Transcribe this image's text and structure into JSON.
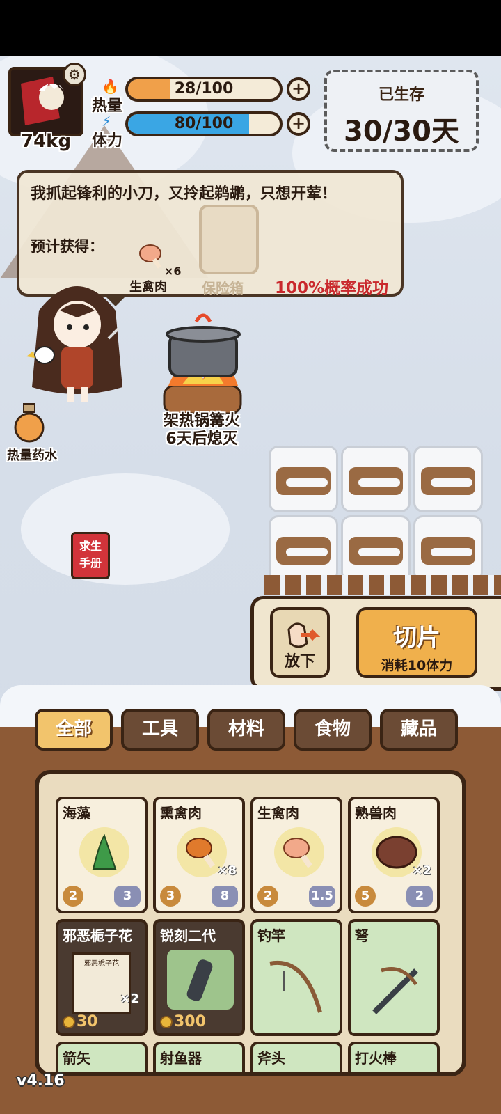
{
  "hud": {
    "weight": "74kg",
    "heat": {
      "label": "热量",
      "value": "28/100",
      "fraction": 0.28
    },
    "stamina": {
      "label": "体力",
      "value": "80/100",
      "fraction": 0.8
    },
    "survival": {
      "label": "已生存",
      "value": "30/30天"
    }
  },
  "dialog": {
    "text": "我抓起锋利的小刀，又拎起鹈鹕，只想开荤！",
    "expected_label": "预计获得：",
    "reward_name": "生禽肉",
    "reward_qty": "×6",
    "faded_item": "保险箱",
    "success_rate": "100%概率成功"
  },
  "scene": {
    "fire_label": "架热锅篝火",
    "fire_timer": "6天后熄灭",
    "potion_label": "热量药水",
    "manual_label_1": "求生",
    "manual_label_2": "手册"
  },
  "actions": {
    "drop_label": "放下",
    "slice_label": "切片",
    "slice_cost": "消耗10体力"
  },
  "tabs": [
    {
      "label": "全部",
      "active": true
    },
    {
      "label": "工具",
      "active": false
    },
    {
      "label": "材料",
      "active": false
    },
    {
      "label": "食物",
      "active": false
    },
    {
      "label": "藏品",
      "active": false
    }
  ],
  "inventory": {
    "row1": [
      {
        "name": "海藻",
        "left": "2",
        "right": "3",
        "qty": ""
      },
      {
        "name": "熏禽肉",
        "left": "3",
        "right": "8",
        "qty": "×8"
      },
      {
        "name": "生禽肉",
        "left": "2",
        "right": "1.5",
        "qty": ""
      },
      {
        "name": "熟兽肉",
        "left": "5",
        "right": "2",
        "qty": "×2"
      }
    ],
    "row2": [
      {
        "name": "邪恶栀子花",
        "price": "30",
        "qty": "×2",
        "book_text": "邪恶栀子花"
      },
      {
        "name": "锐刻二代",
        "price": "300",
        "qty": ""
      },
      {
        "name": "钓竿",
        "price": "",
        "qty": ""
      },
      {
        "name": "弩",
        "price": "",
        "qty": ""
      }
    ],
    "row3": [
      {
        "name": "箭矢"
      },
      {
        "name": "射鱼器"
      },
      {
        "name": "斧头"
      },
      {
        "name": "打火棒"
      }
    ]
  },
  "version": "v4.16",
  "colors": {
    "heat": "#f0a04a",
    "stamina": "#3aa6e4",
    "accent": "#f2c46c",
    "danger": "#c9282c"
  }
}
